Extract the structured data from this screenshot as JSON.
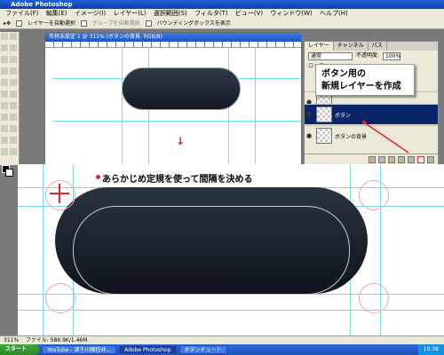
{
  "app": {
    "title": "Adobe Photoshop"
  },
  "menu": [
    "ファイル(F)",
    "編集(E)",
    "イメージ(I)",
    "レイヤー(L)",
    "選択範囲(S)",
    "フィルタ(T)",
    "ビュー(V)",
    "ウィンドウ(W)",
    "ヘルプ(H)"
  ],
  "options": {
    "auto_select": "レイヤーを自動選択",
    "group_auto": "グループを自動選択",
    "bounding": "バウンディングボックスを表示"
  },
  "document": {
    "title": "名称未設定 1 @ 311% (ボタンの背景, RGB/8)"
  },
  "layers_panel": {
    "tabs": [
      "レイヤー",
      "チャンネル",
      "パス"
    ],
    "blend_mode": "通常",
    "opacity_label": "不透明度:",
    "opacity": "100%",
    "lock_label": "ロック:",
    "layers": [
      {
        "name": "ボタン",
        "selected": true
      },
      {
        "name": "ボタンの背景",
        "selected": false
      }
    ]
  },
  "callouts": {
    "new_layer": [
      "ボタン用の",
      "新規レイヤーを作成"
    ],
    "guides": "あらかじめ定規を使って間隔を決める"
  },
  "status": {
    "zoom": "311%",
    "file": "ファイル: 586.9K/1.46M"
  },
  "taskbar": {
    "start": "スタート",
    "tasks": [
      "YouTube - 津千川横任井...",
      "Adobe Photoshop",
      "ボタンチュート"
    ],
    "clock": "19:38"
  },
  "colors": {
    "accent_red": "#e0282a",
    "guide_cyan": "#6fe0f0",
    "button_dark": "#141a24"
  }
}
